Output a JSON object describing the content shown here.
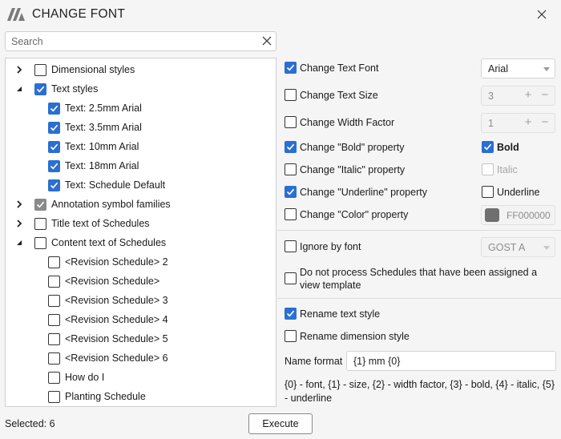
{
  "window": {
    "title": "CHANGE FONT"
  },
  "search": {
    "placeholder": "Search",
    "value": ""
  },
  "tree": [
    {
      "label": "Dimensional styles",
      "expander": "collapsed",
      "checked": "off",
      "level": 0
    },
    {
      "label": "Text styles",
      "expander": "expanded",
      "checked": "on",
      "level": 0
    },
    {
      "label": "Text: 2.5mm Arial",
      "expander": "none",
      "checked": "on",
      "level": 1
    },
    {
      "label": "Text: 3.5mm Arial",
      "expander": "none",
      "checked": "on",
      "level": 1
    },
    {
      "label": "Text: 10mm Arial",
      "expander": "none",
      "checked": "on",
      "level": 1
    },
    {
      "label": "Text: 18mm Arial",
      "expander": "none",
      "checked": "on",
      "level": 1
    },
    {
      "label": "Text: Schedule Default",
      "expander": "none",
      "checked": "on",
      "level": 1
    },
    {
      "label": "Annotation symbol families",
      "expander": "collapsed",
      "checked": "partial",
      "level": 0
    },
    {
      "label": "Title text of Schedules",
      "expander": "collapsed",
      "checked": "off",
      "level": 0
    },
    {
      "label": "Content text of Schedules",
      "expander": "expanded",
      "checked": "off",
      "level": 0
    },
    {
      "label": "<Revision Schedule> 2",
      "expander": "none",
      "checked": "off",
      "level": 1
    },
    {
      "label": "<Revision Schedule>",
      "expander": "none",
      "checked": "off",
      "level": 1
    },
    {
      "label": "<Revision Schedule> 3",
      "expander": "none",
      "checked": "off",
      "level": 1
    },
    {
      "label": "<Revision Schedule> 4",
      "expander": "none",
      "checked": "off",
      "level": 1
    },
    {
      "label": "<Revision Schedule> 5",
      "expander": "none",
      "checked": "off",
      "level": 1
    },
    {
      "label": "<Revision Schedule> 6",
      "expander": "none",
      "checked": "off",
      "level": 1
    },
    {
      "label": "How do I",
      "expander": "none",
      "checked": "off",
      "level": 1
    },
    {
      "label": "Planting Schedule",
      "expander": "none",
      "checked": "off",
      "level": 1
    }
  ],
  "options": {
    "change_font": {
      "label": "Change Text Font",
      "checked": true,
      "value": "Arial"
    },
    "change_size": {
      "label": "Change Text Size",
      "checked": false,
      "value": "3"
    },
    "change_width": {
      "label": "Change Width Factor",
      "checked": false,
      "value": "1"
    },
    "bold_prop": {
      "label": "Change \"Bold\" property",
      "checked": true,
      "value_label": "Bold",
      "value_checked": true
    },
    "italic_prop": {
      "label": "Change \"Italic\" property",
      "checked": false,
      "value_label": "Italic",
      "value_checked": false
    },
    "underline_prop": {
      "label": "Change \"Underline\" property",
      "checked": true,
      "value_label": "Underline",
      "value_checked": false
    },
    "color_prop": {
      "label": "Change \"Color\" property",
      "checked": false,
      "value": "FF000000",
      "swatch": "#6f6f6f"
    },
    "ignore_font": {
      "label": "Ignore by font",
      "checked": false,
      "value": "GOST A"
    },
    "no_template": {
      "label": "Do not process Schedules that have been assigned a view template",
      "checked": false
    },
    "rename_text": {
      "label": "Rename text style",
      "checked": true
    },
    "rename_dim": {
      "label": "Rename dimension style",
      "checked": false
    },
    "name_format": {
      "label": "Name format",
      "value": "{1} mm {0}"
    },
    "hint": "{0} - font, {1} - size, {2} - width factor, {3} - bold, {4} - italic, {5} - underline"
  },
  "footer": {
    "status": "Selected: 6",
    "execute_label": "Execute"
  },
  "colors": {
    "accent": "#2a6fd1",
    "partial": "#8a8a8a"
  }
}
